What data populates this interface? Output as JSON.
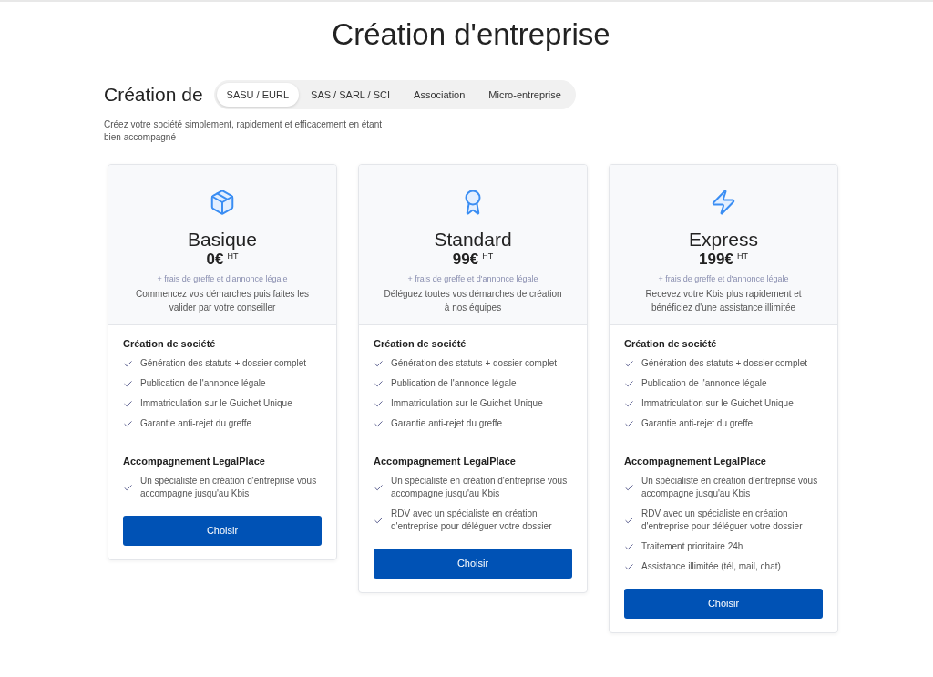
{
  "page": {
    "title": "Création d'entreprise"
  },
  "selector": {
    "label": "Création de",
    "tabs": [
      {
        "label": "SASU / EURL",
        "selected": true
      },
      {
        "label": "SAS / SARL / SCI",
        "selected": false
      },
      {
        "label": "Association",
        "selected": false
      },
      {
        "label": "Micro-entreprise",
        "selected": false
      }
    ]
  },
  "intro": "Créez votre société simplement, rapidement et efficacement en étant bien accompagné",
  "plans": [
    {
      "name": "Basique",
      "price": "0€",
      "price_unit": "HT",
      "fees": "+ frais de greffe et d'annonce légale",
      "description": "Commencez vos démarches puis faites les valider par votre conseiller",
      "sections": [
        {
          "title": "Création de société",
          "features": [
            "Génération des statuts + dossier complet",
            "Publication de l'annonce légale",
            "Immatriculation sur le Guichet Unique",
            "Garantie anti-rejet du greffe"
          ]
        },
        {
          "title": "Accompagnement LegalPlace",
          "features": [
            "Un spécialiste en création d'entreprise vous accompagne jusqu'au Kbis"
          ]
        }
      ],
      "button": "Choisir"
    },
    {
      "name": "Standard",
      "price": "99€",
      "price_unit": "HT",
      "fees": "+ frais de greffe et d'annonce légale",
      "description": "Déléguez toutes vos démarches de création à nos équipes",
      "sections": [
        {
          "title": "Création de société",
          "features": [
            "Génération des statuts + dossier complet",
            "Publication de l'annonce légale",
            "Immatriculation sur le Guichet Unique",
            "Garantie anti-rejet du greffe"
          ]
        },
        {
          "title": "Accompagnement LegalPlace",
          "features": [
            "Un spécialiste en création d'entreprise vous accompagne jusqu'au Kbis",
            "RDV avec un spécialiste en création d'entreprise pour déléguer votre dossier"
          ]
        }
      ],
      "button": "Choisir"
    },
    {
      "name": "Express",
      "price": "199€",
      "price_unit": "HT",
      "fees": "+ frais de greffe et d'annonce légale",
      "description": "Recevez votre Kbis plus rapidement et bénéficiez d'une assistance illimitée",
      "sections": [
        {
          "title": "Création de société",
          "features": [
            "Génération des statuts + dossier complet",
            "Publication de l'annonce légale",
            "Immatriculation sur le Guichet Unique",
            "Garantie anti-rejet du greffe"
          ]
        },
        {
          "title": "Accompagnement LegalPlace",
          "features": [
            "Un spécialiste en création d'entreprise vous accompagne jusqu'au Kbis",
            "RDV avec un spécialiste en création d'entreprise pour déléguer votre dossier",
            "Traitement prioritaire 24h",
            "Assistance illimitée (tél, mail, chat)"
          ]
        }
      ],
      "button": "Choisir"
    }
  ]
}
